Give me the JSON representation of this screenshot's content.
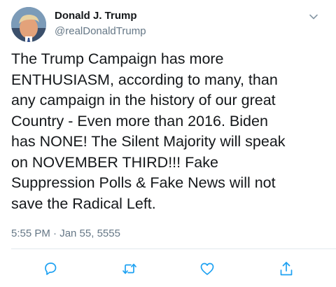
{
  "tweet": {
    "author_name": "Donald J. Trump",
    "author_handle": "@realDonaldTrump",
    "text": "The Trump Campaign has more\nENTHUSIASM, according to many, than\nany campaign in the history of our great\nCountry - Even more than 2016. Biden\nhas NONE! The Silent Majority will speak\non NOVEMBER THIRD!!! Fake\nSuppression Polls & Fake News will not\nsave the Radical Left.",
    "timestamp": "5:55 PM · Jan 55, 5555"
  },
  "icons": {
    "menu": "chevron-down-icon",
    "reply": "reply-icon",
    "retweet": "retweet-icon",
    "like": "heart-icon",
    "share": "share-icon"
  },
  "colors": {
    "text": "#14171a",
    "secondary": "#657786",
    "icon": "#1da1f2",
    "divider": "#e1e8ed"
  }
}
